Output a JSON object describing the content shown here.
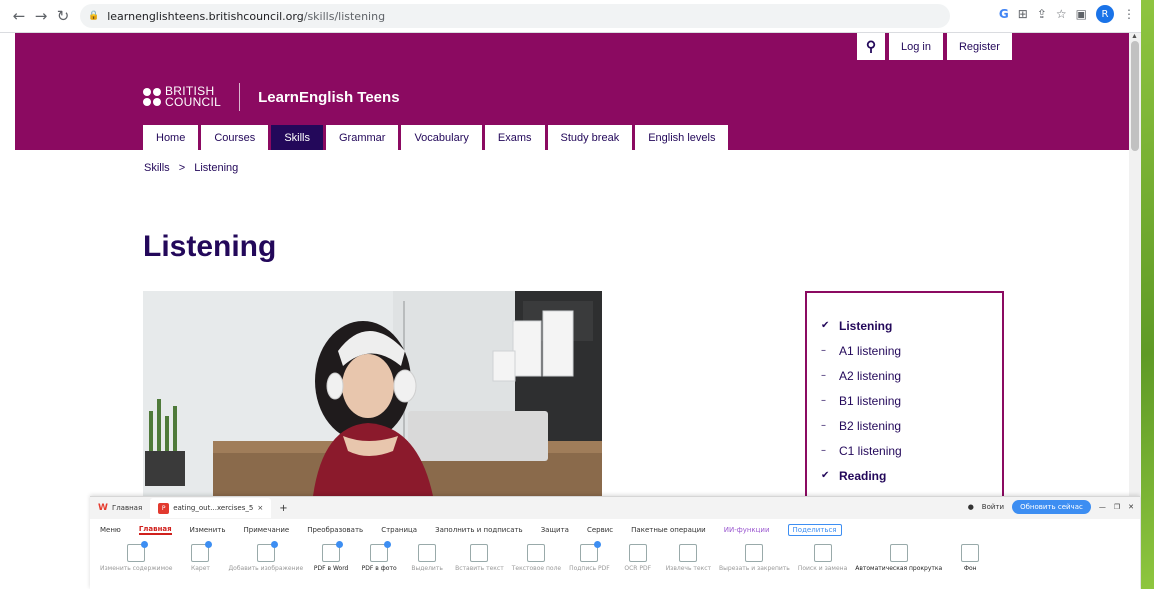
{
  "browser": {
    "url_host": "learnenglishteens.britishcouncil.org",
    "url_path": "/skills/listening",
    "avatar_letter": "R"
  },
  "header": {
    "top_links": [
      "Log in",
      "Register"
    ],
    "logo_line1": "BRITISH",
    "logo_line2": "COUNCIL",
    "brand": "LearnEnglish Teens"
  },
  "nav": {
    "tabs": [
      {
        "label": "Home",
        "active": false
      },
      {
        "label": "Courses",
        "active": false
      },
      {
        "label": "Skills",
        "active": true
      },
      {
        "label": "Grammar",
        "active": false
      },
      {
        "label": "Vocabulary",
        "active": false
      },
      {
        "label": "Exams",
        "active": false
      },
      {
        "label": "Study break",
        "active": false
      },
      {
        "label": "English levels",
        "active": false
      }
    ]
  },
  "breadcrumb": {
    "parent": "Skills",
    "separator": ">",
    "current": "Listening"
  },
  "page": {
    "title": "Listening"
  },
  "sidebar": {
    "items": [
      {
        "label": "Listening",
        "type": "head"
      },
      {
        "label": "A1 listening",
        "type": "sub"
      },
      {
        "label": "A2 listening",
        "type": "sub"
      },
      {
        "label": "B1 listening",
        "type": "sub"
      },
      {
        "label": "B2 listening",
        "type": "sub"
      },
      {
        "label": "C1 listening",
        "type": "sub"
      },
      {
        "label": "Reading",
        "type": "head"
      }
    ]
  },
  "wps": {
    "home_tab": "Главная",
    "doc_tab": "eating_out...xercises_5",
    "login": "Войти",
    "update": "Обновить сейчас",
    "menu": [
      "Меню",
      "Главная",
      "Изменить",
      "Примечание",
      "Преобразовать",
      "Страница",
      "Заполнить и подписать",
      "Защита",
      "Сервис",
      "Пакетные операции"
    ],
    "ai": "ИИ-функции",
    "share": "Поделиться",
    "tools": [
      {
        "label": "Изменить содержимое",
        "on": false
      },
      {
        "label": "Карет",
        "on": false
      },
      {
        "label": "Добавить изображение",
        "on": false
      },
      {
        "label": "PDF в Word",
        "on": true
      },
      {
        "label": "PDF в фото",
        "on": true
      },
      {
        "label": "Выделить",
        "on": false
      },
      {
        "label": "Вставить текст",
        "on": false
      },
      {
        "label": "Текстовое поле",
        "on": false
      },
      {
        "label": "Подпись PDF",
        "on": false
      },
      {
        "label": "OCR PDF",
        "on": false
      },
      {
        "label": "Извлечь текст",
        "on": false
      },
      {
        "label": "Вырезать и закрепить",
        "on": false
      },
      {
        "label": "Поиск и замена",
        "on": false
      },
      {
        "label": "Автоматическая прокрутка",
        "on": true
      },
      {
        "label": "Фон",
        "on": true
      }
    ]
  }
}
